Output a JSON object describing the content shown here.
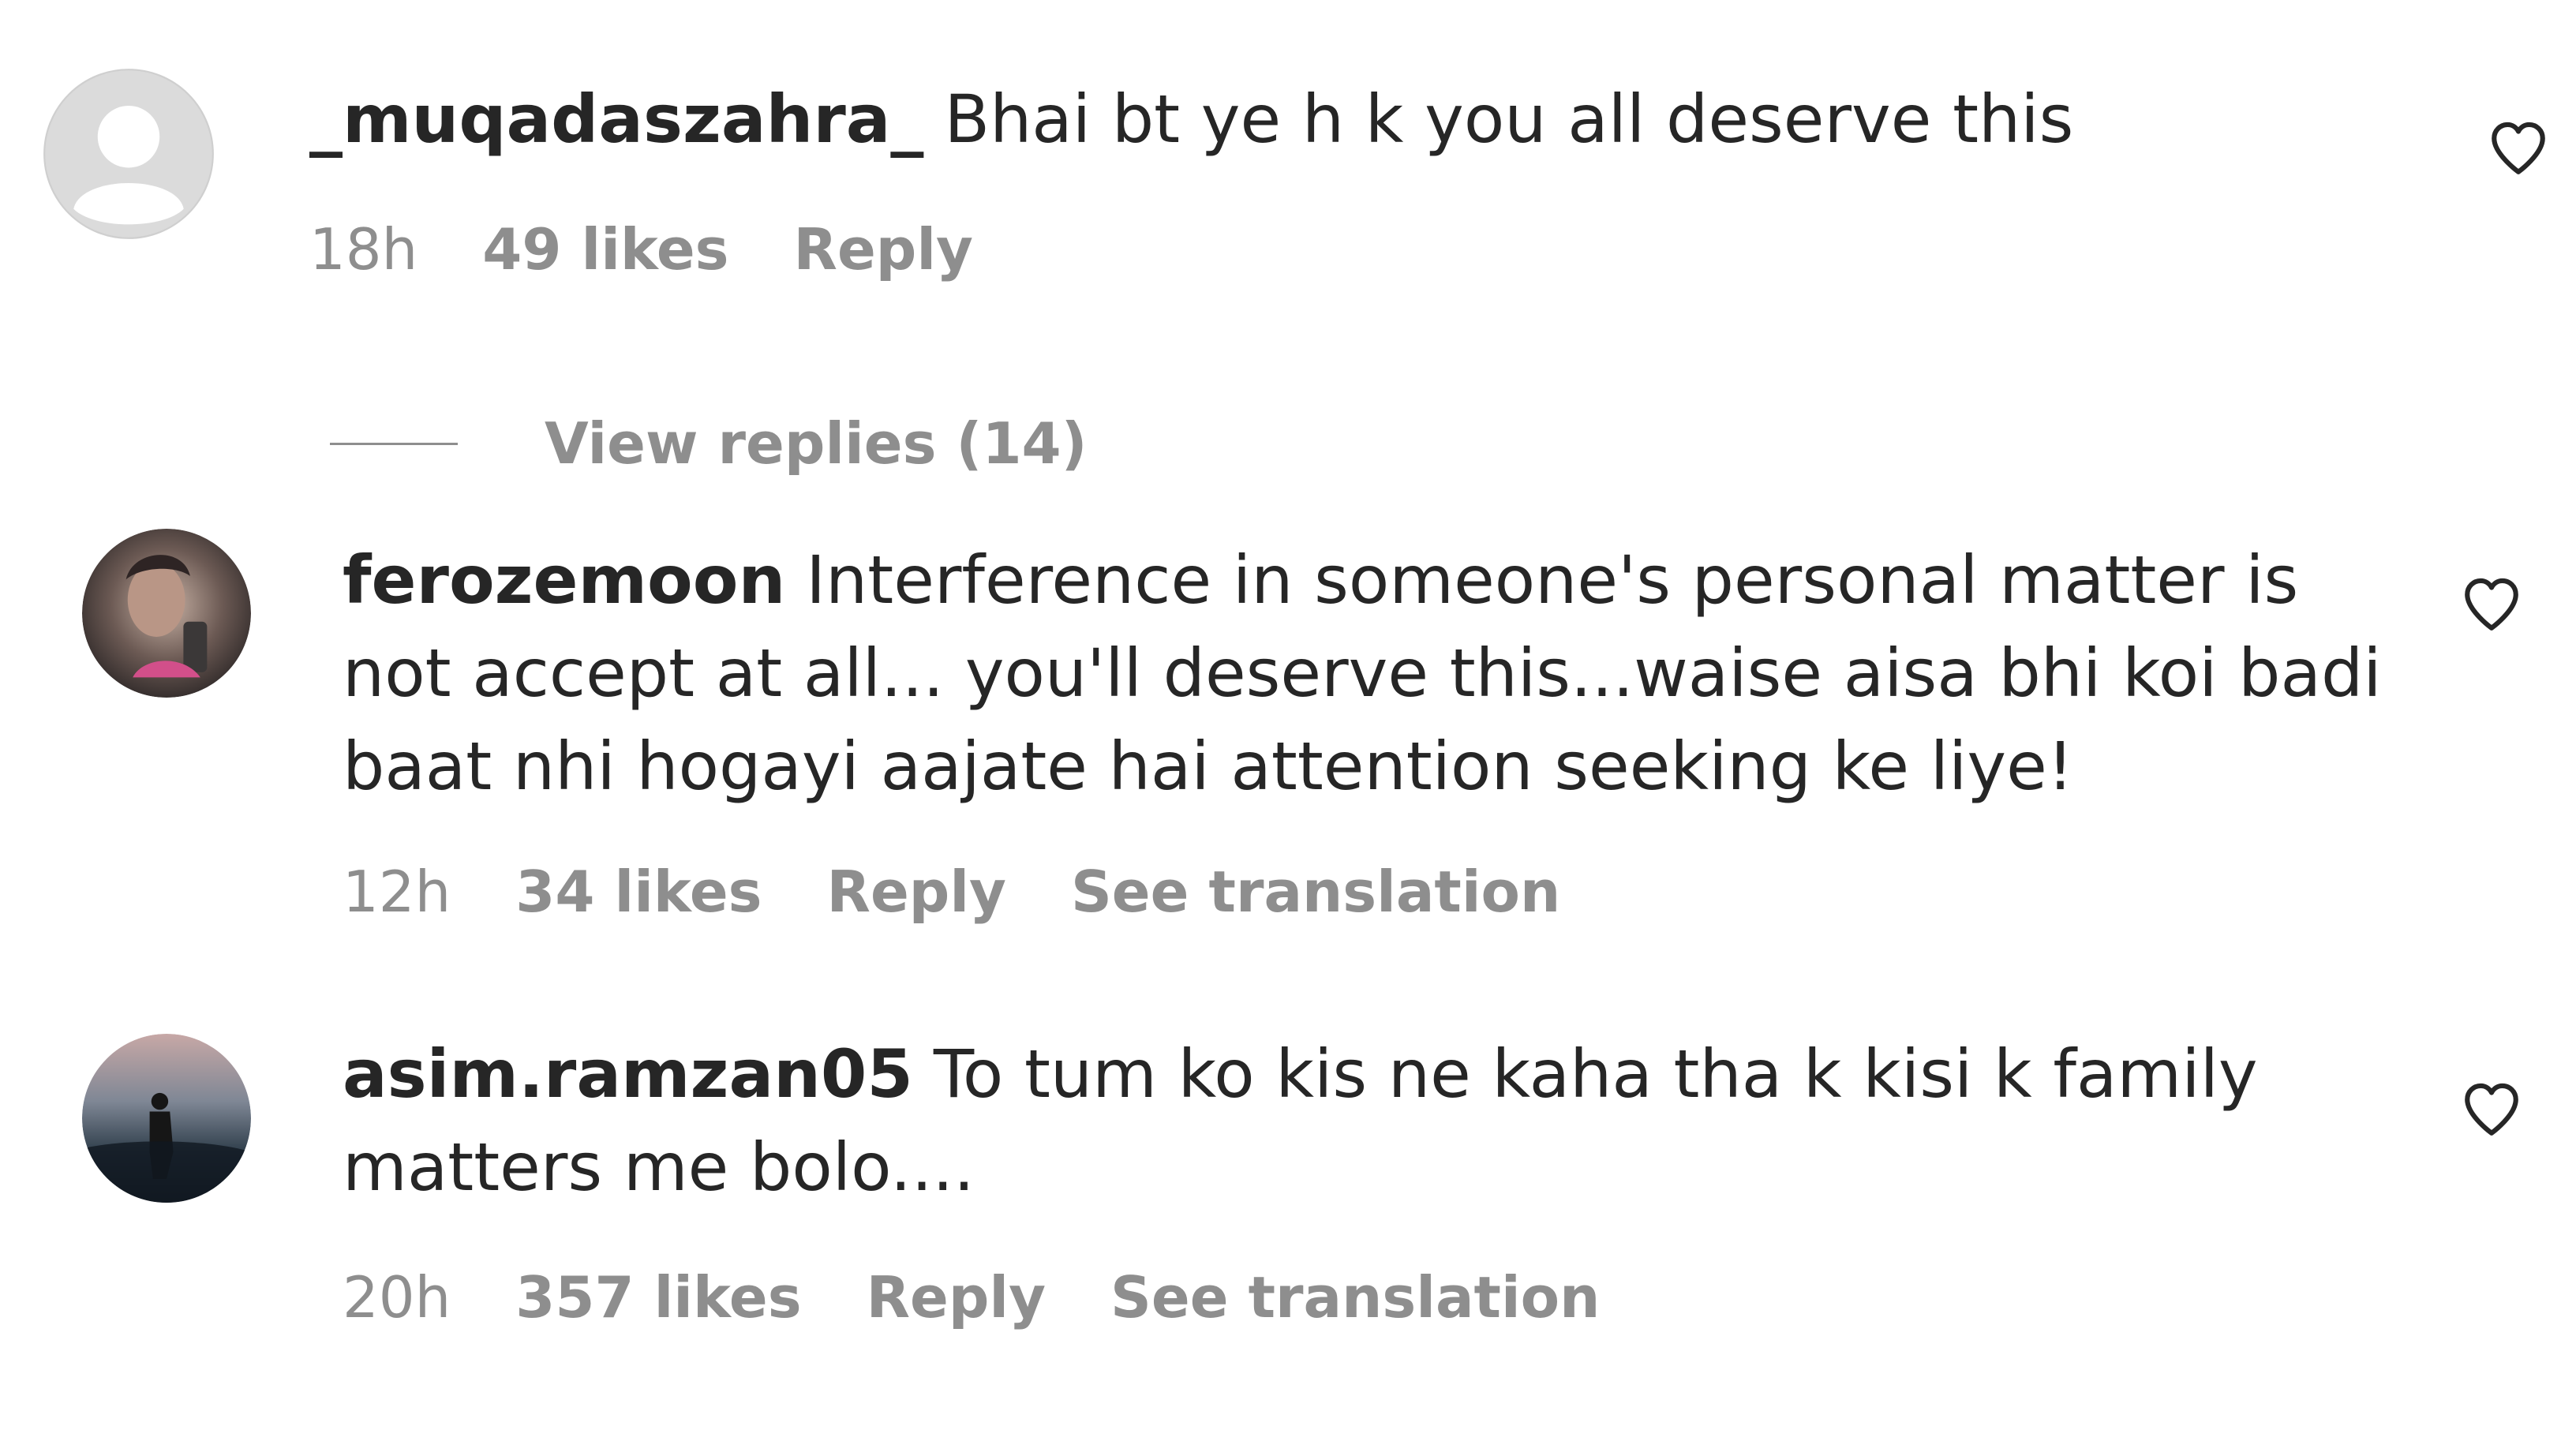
{
  "comments": [
    {
      "username": "_muqadaszahra_",
      "text": "Bhai bt ye h k you all deserve this",
      "time": "18h",
      "likes": "49 likes",
      "reply": "Reply"
    },
    {
      "username": "ferozemoon",
      "text": "Interference in someone's personal matter is not accept at all... you'll deserve this...waise aisa bhi koi badi baat nhi hogayi aajate hai attention seeking ke liye!",
      "time": "12h",
      "likes": "34 likes",
      "reply": "Reply",
      "translate": "See translation"
    },
    {
      "username": "asim.ramzan05",
      "text": "To tum ko kis ne kaha tha k kisi k family matters me bolo....",
      "time": "20h",
      "likes": "357 likes",
      "reply": "Reply",
      "translate": "See translation"
    }
  ],
  "view_replies": "View replies (14)",
  "icons": {
    "like": "heart-outline-icon",
    "default_avatar": "default-avatar-icon"
  },
  "colors": {
    "text": "#262626",
    "secondary": "#8e8e8e",
    "avatar_placeholder": "#dbdbdb"
  }
}
